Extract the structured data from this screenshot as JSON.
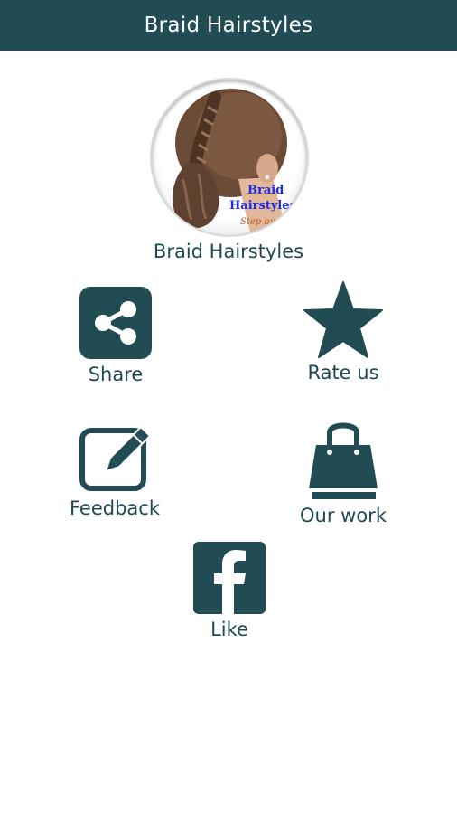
{
  "appbar": {
    "title": "Braid Hairstyles"
  },
  "logo": {
    "line1": "Braid",
    "line2": "Hairstyles",
    "line3": "Step by Step"
  },
  "app_name": "Braid Hairstyles",
  "actions": {
    "share": {
      "label": "Share",
      "icon": "share-icon"
    },
    "rate": {
      "label": "Rate us",
      "icon": "star-icon"
    },
    "feedback": {
      "label": "Feedback",
      "icon": "edit-icon"
    },
    "our_work": {
      "label": "Our work",
      "icon": "shopping-bag-icon"
    },
    "like": {
      "label": "Like",
      "icon": "facebook-icon"
    }
  },
  "colors": {
    "primary": "#224c54",
    "background": "#ffffff",
    "logo_text": "#1b2de0"
  }
}
